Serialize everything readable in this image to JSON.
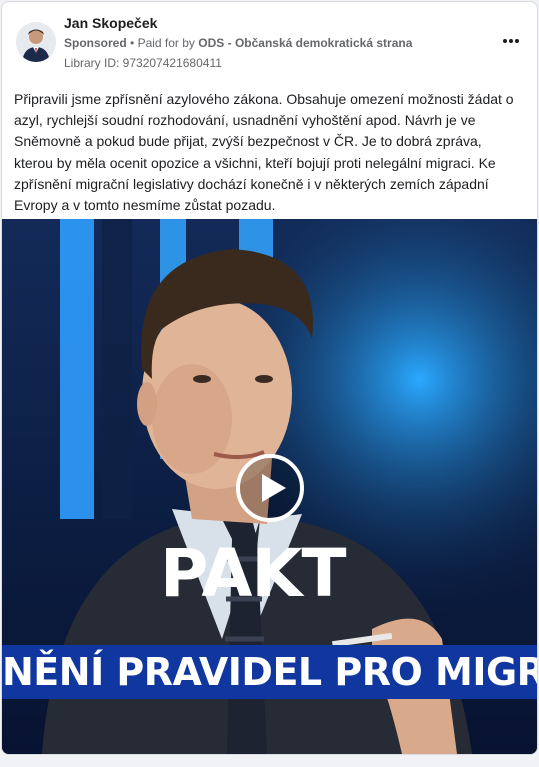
{
  "post": {
    "author": "Jan Skopeček",
    "sponsored_label": "Sponsored",
    "paid_for_prefix": "Paid for by",
    "sponsor": "ODS - Občanská demokratická strana",
    "library_id": "Library ID: 973207421680411",
    "more_icon": "more-options-icon",
    "text": "Připravili jsme zpřísnění azylového zákona. Obsahuje omezení možnosti žádat o azyl, rychlejší soudní rozhodování, usnadnění vyhoštění apod. Návrh je ve Sněmovně a pokud bude přijat, zvýší bezpečnost v ČR. Je to dobrá zpráva, kterou by měla ocenit opozice a všichni, kteří bojují proti nelegální migraci. Ke zpřísnění migrační legislativy dochází konečně i v některých zemích západní Evropy a v tomto nesmíme zůstat pozadu."
  },
  "video": {
    "overlay_title": "PAKT",
    "ticker_text": "NĚNÍ PRAVIDEL PRO MIGRANTY",
    "play_icon": "play-icon"
  },
  "colors": {
    "ticker_bg": "#1036a0",
    "background_blue": "#0a1a3a",
    "accent_light": "#1e90ff"
  }
}
